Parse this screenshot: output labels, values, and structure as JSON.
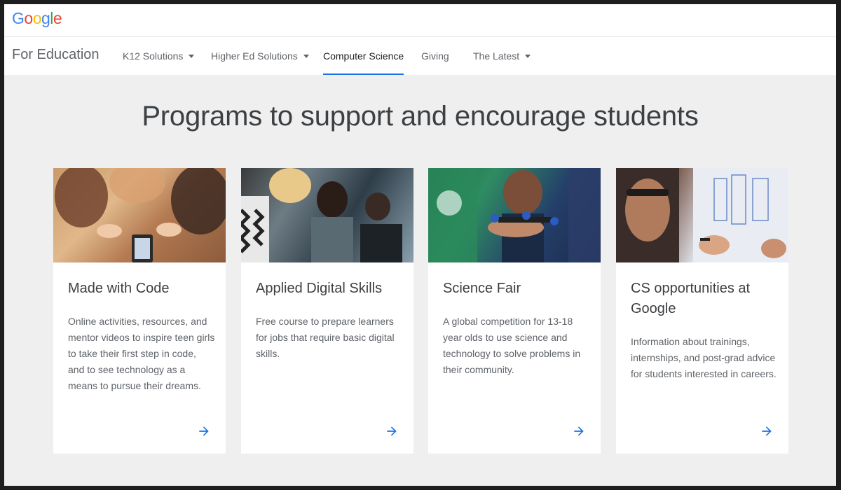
{
  "header": {
    "logo_text": "Google",
    "logo_colors": [
      "#4285F4",
      "#EA4335",
      "#FBBC05",
      "#4285F4",
      "#34A853",
      "#EA4335"
    ]
  },
  "nav": {
    "brand": "For Education",
    "items": [
      {
        "label": "K12 Solutions",
        "dropdown": true
      },
      {
        "label": "Higher Ed Solutions",
        "dropdown": true
      },
      {
        "label": "Computer Science",
        "dropdown": false,
        "active": true
      },
      {
        "label": "Giving",
        "dropdown": false
      },
      {
        "label": "The Latest",
        "dropdown": true
      }
    ],
    "active_color": "#1a73e8"
  },
  "main": {
    "headline": "Programs to support and encourage students",
    "cards": [
      {
        "title": "Made with Code",
        "description": "Online activities, resources, and mentor videos to inspire teen girls to take their first step in code, and to see technology as a means to pursue their dreams.",
        "image": "girls-with-tablet-photo",
        "arrow": "arrow-right-icon"
      },
      {
        "title": "Applied Digital Skills",
        "description": "Free course to prepare learners for jobs that require basic digital skills.",
        "image": "students-at-laptops-photo",
        "arrow": "arrow-right-icon"
      },
      {
        "title": "Science Fair",
        "description": "A global competition for 13-18 year olds to use science and technology to solve problems in their community.",
        "image": "student-holding-drone-photo",
        "arrow": "arrow-right-icon"
      },
      {
        "title": "CS opportunities at Google",
        "description": "Information about trainings, internships, and post-grad advice for students interested in careers.",
        "image": "student-at-whiteboard-photo",
        "arrow": "arrow-right-icon"
      }
    ],
    "arrow_color": "#1a73e8"
  }
}
